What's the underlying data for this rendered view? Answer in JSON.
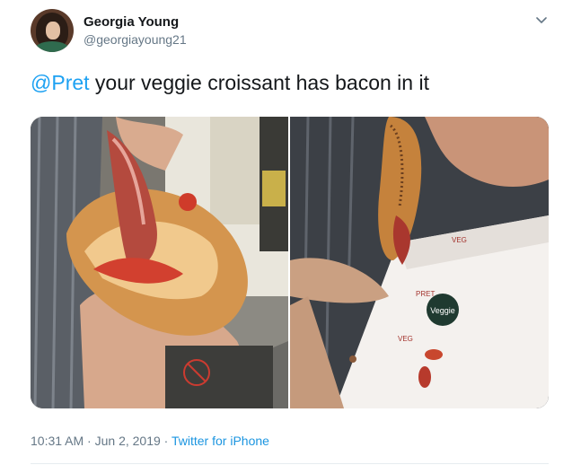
{
  "user": {
    "display_name": "Georgia Young",
    "handle": "@georgiayoung21"
  },
  "tweet": {
    "mention": "@Pret",
    "text": " your veggie croissant has bacon in it"
  },
  "media": {
    "photos": [
      "photo-1",
      "photo-2"
    ],
    "box_label": "Veggie"
  },
  "meta": {
    "time": "10:31 AM",
    "separator1": " · ",
    "date": "Jun 2, 2019",
    "separator2": " · ",
    "source": "Twitter for iPhone"
  },
  "icons": {
    "more": "chevron-down-icon"
  },
  "colors": {
    "link": "#1da1f2",
    "muted": "#657786",
    "text": "#14171a"
  }
}
